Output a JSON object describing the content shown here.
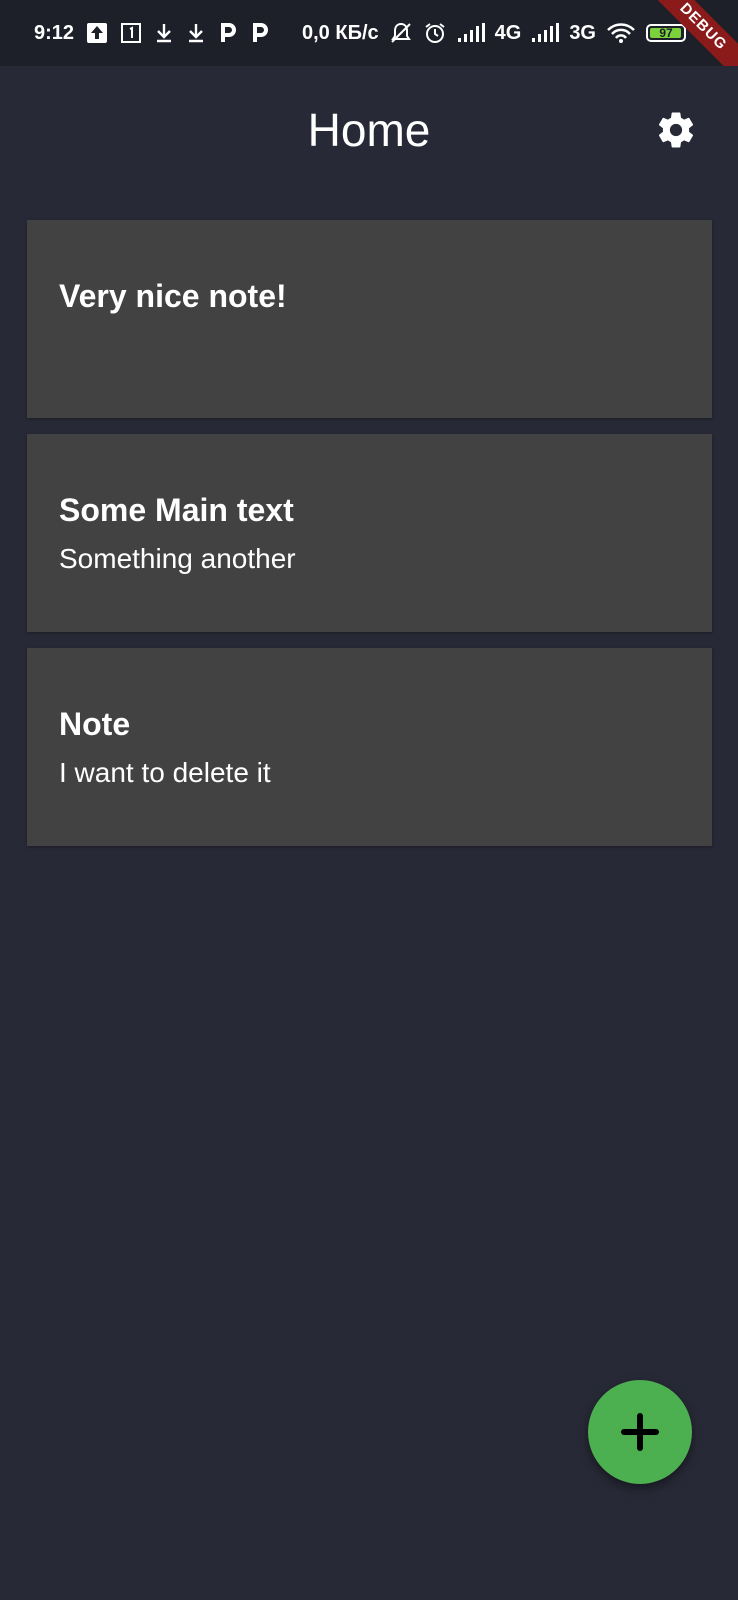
{
  "status_bar": {
    "time": "9:12",
    "network_speed": "0,0 КБ/с",
    "signal_1_label": "4G",
    "signal_2_label": "3G",
    "battery_level": "97",
    "battery_fraction": 0.97,
    "icons": [
      "upload-icon",
      "sim-1-icon",
      "download-icon",
      "download-icon",
      "parking-icon",
      "parking-icon",
      "mute-icon",
      "alarm-icon",
      "signal-icon",
      "signal-icon",
      "wifi-icon",
      "battery-icon"
    ]
  },
  "debug_banner": "DEBUG",
  "app_bar": {
    "title": "Home",
    "settings_icon": "gear-icon"
  },
  "notes": [
    {
      "title": "Very nice note!",
      "body": ""
    },
    {
      "title": "Some Main text",
      "body": "Something another"
    },
    {
      "title": "Note",
      "body": "I want to delete it"
    }
  ],
  "fab": {
    "icon": "plus-icon",
    "color": "#4caf50"
  },
  "colors": {
    "background": "#272936",
    "card": "#424242",
    "status_bar": "#1d1f29",
    "accent": "#4caf50",
    "battery": "#7bd23b",
    "debug_ribbon": "#8b1a1a"
  }
}
